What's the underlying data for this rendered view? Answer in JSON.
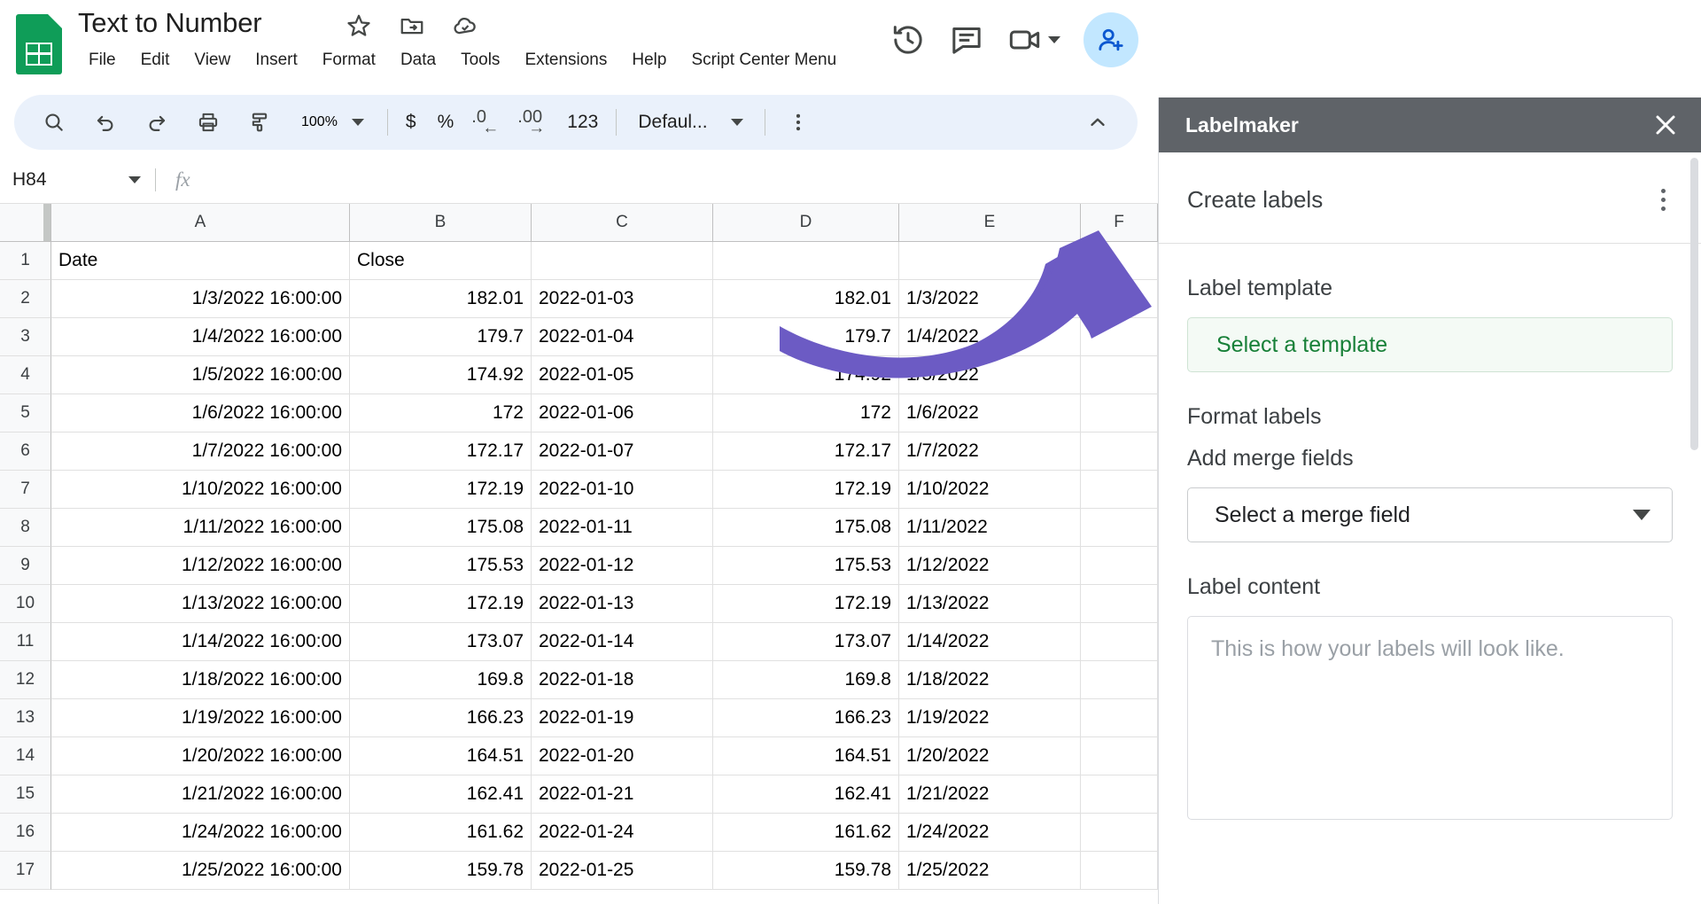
{
  "app": {
    "doc_title": "Text to Number",
    "logo_icon": "sheets-logo-icon",
    "title_icons": [
      "star-icon",
      "move-to-folder-icon",
      "cloud-saved-icon"
    ],
    "menu": [
      "File",
      "Edit",
      "View",
      "Insert",
      "Format",
      "Data",
      "Tools",
      "Extensions",
      "Help",
      "Script Center Menu"
    ],
    "header_icons": [
      "history-icon",
      "comment-icon",
      "video-camera-icon",
      "chevron-down-icon"
    ],
    "avatar_icon": "add-person-icon",
    "accent_green": "#0f9d58",
    "toolbar_bg": "#eaf1fb",
    "sidebar_header_bg": "#5f6368",
    "arrow_color": "#6c5bc4"
  },
  "toolbar": {
    "icons": [
      "search-icon",
      "undo-icon",
      "redo-icon",
      "print-icon",
      "paint-format-icon"
    ],
    "zoom": "100%",
    "currency": "$",
    "percent": "%",
    "decrease_decimal": ".0",
    "decrease_decimal_arrow": "←",
    "increase_decimal": ".00",
    "increase_decimal_arrow": "→",
    "number_format": "123",
    "font": "Defaul...",
    "more_icon": "more-vertical-icon",
    "collapse_icon": "chevron-up-icon"
  },
  "formula_bar": {
    "name_box": "H84",
    "fx": "fx",
    "value": ""
  },
  "grid": {
    "columns": [
      "A",
      "B",
      "C",
      "D",
      "E",
      "F"
    ],
    "rows": [
      {
        "n": "1",
        "a": "Date",
        "b": "Close",
        "c": "",
        "d": "",
        "e": "",
        "f": ""
      },
      {
        "n": "2",
        "a": "1/3/2022 16:00:00",
        "b": "182.01",
        "c": "2022-01-03",
        "d": "182.01",
        "e": "1/3/2022",
        "f": ""
      },
      {
        "n": "3",
        "a": "1/4/2022 16:00:00",
        "b": "179.7",
        "c": "2022-01-04",
        "d": "179.7",
        "e": "1/4/2022",
        "f": ""
      },
      {
        "n": "4",
        "a": "1/5/2022 16:00:00",
        "b": "174.92",
        "c": "2022-01-05",
        "d": "174.92",
        "e": "1/5/2022",
        "f": ""
      },
      {
        "n": "5",
        "a": "1/6/2022 16:00:00",
        "b": "172",
        "c": "2022-01-06",
        "d": "172",
        "e": "1/6/2022",
        "f": ""
      },
      {
        "n": "6",
        "a": "1/7/2022 16:00:00",
        "b": "172.17",
        "c": "2022-01-07",
        "d": "172.17",
        "e": "1/7/2022",
        "f": ""
      },
      {
        "n": "7",
        "a": "1/10/2022 16:00:00",
        "b": "172.19",
        "c": "2022-01-10",
        "d": "172.19",
        "e": "1/10/2022",
        "f": ""
      },
      {
        "n": "8",
        "a": "1/11/2022 16:00:00",
        "b": "175.08",
        "c": "2022-01-11",
        "d": "175.08",
        "e": "1/11/2022",
        "f": ""
      },
      {
        "n": "9",
        "a": "1/12/2022 16:00:00",
        "b": "175.53",
        "c": "2022-01-12",
        "d": "175.53",
        "e": "1/12/2022",
        "f": ""
      },
      {
        "n": "10",
        "a": "1/13/2022 16:00:00",
        "b": "172.19",
        "c": "2022-01-13",
        "d": "172.19",
        "e": "1/13/2022",
        "f": ""
      },
      {
        "n": "11",
        "a": "1/14/2022 16:00:00",
        "b": "173.07",
        "c": "2022-01-14",
        "d": "173.07",
        "e": "1/14/2022",
        "f": ""
      },
      {
        "n": "12",
        "a": "1/18/2022 16:00:00",
        "b": "169.8",
        "c": "2022-01-18",
        "d": "169.8",
        "e": "1/18/2022",
        "f": ""
      },
      {
        "n": "13",
        "a": "1/19/2022 16:00:00",
        "b": "166.23",
        "c": "2022-01-19",
        "d": "166.23",
        "e": "1/19/2022",
        "f": ""
      },
      {
        "n": "14",
        "a": "1/20/2022 16:00:00",
        "b": "164.51",
        "c": "2022-01-20",
        "d": "164.51",
        "e": "1/20/2022",
        "f": ""
      },
      {
        "n": "15",
        "a": "1/21/2022 16:00:00",
        "b": "162.41",
        "c": "2022-01-21",
        "d": "162.41",
        "e": "1/21/2022",
        "f": ""
      },
      {
        "n": "16",
        "a": "1/24/2022 16:00:00",
        "b": "161.62",
        "c": "2022-01-24",
        "d": "161.62",
        "e": "1/24/2022",
        "f": ""
      },
      {
        "n": "17",
        "a": "1/25/2022 16:00:00",
        "b": "159.78",
        "c": "2022-01-25",
        "d": "159.78",
        "e": "1/25/2022",
        "f": ""
      }
    ]
  },
  "sidebar": {
    "title": "Labelmaker",
    "close_icon": "close-icon",
    "create_labels": "Create labels",
    "kebab_icon": "more-vertical-icon",
    "label_template_heading": "Label template",
    "select_template_button": "Select a template",
    "format_labels_heading": "Format labels",
    "add_merge_fields_heading": "Add merge fields",
    "merge_field_value": "Select a merge field",
    "label_content_heading": "Label content",
    "label_content_placeholder": "This is how your labels will look like."
  }
}
